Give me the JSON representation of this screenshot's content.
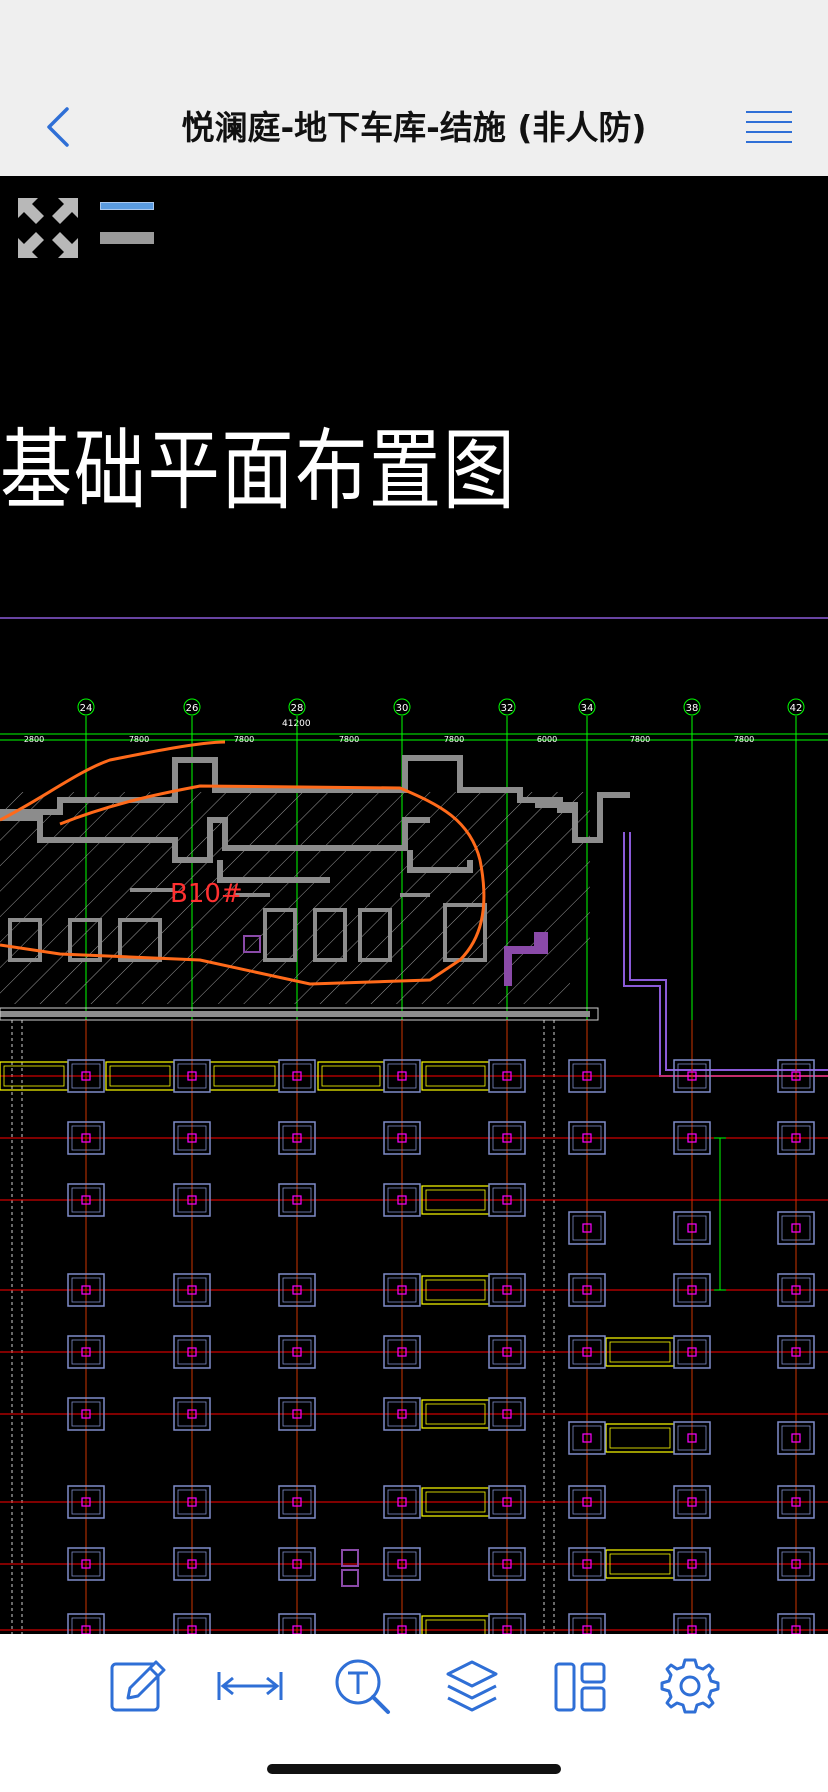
{
  "header": {
    "title": "悦澜庭-地下车库-结施 (非人防)",
    "back_icon": "chevron-left-icon",
    "menu_icon": "hamburger-menu-icon"
  },
  "canvas": {
    "drawing_title": "基础平面布置图",
    "block_label": "B10#",
    "total_dimension": "41200",
    "grid_axes": [
      "24",
      "26",
      "28",
      "30",
      "32",
      "34",
      "38",
      "42"
    ],
    "dimensions": [
      "2800",
      "7800",
      "7800",
      "7800",
      "7800",
      "6000",
      "7800",
      "7800"
    ],
    "colors": {
      "background": "#000000",
      "grid_line": "#00ff00",
      "axis_line": "#ff0000",
      "pile_cap": "#7f8cc9",
      "pile_center": "#ff00ff",
      "beam": "#ffff00",
      "outline": "#ff6a1a",
      "wall": "#8c8c8c",
      "purple_line": "#8a5ad8"
    }
  },
  "overlay": {
    "fullscreen_icon": "expand-arrows-icon",
    "layout_icon": "split-layout-icon"
  },
  "toolbar": {
    "accent_color": "#2f6fd6",
    "items": [
      {
        "name": "annotate",
        "icon": "pencil-edit-icon"
      },
      {
        "name": "measure",
        "icon": "measure-distance-icon"
      },
      {
        "name": "text-search",
        "icon": "text-search-icon"
      },
      {
        "name": "layers",
        "icon": "layers-icon"
      },
      {
        "name": "layout",
        "icon": "layout-panels-icon"
      },
      {
        "name": "settings",
        "icon": "gear-icon"
      }
    ]
  }
}
